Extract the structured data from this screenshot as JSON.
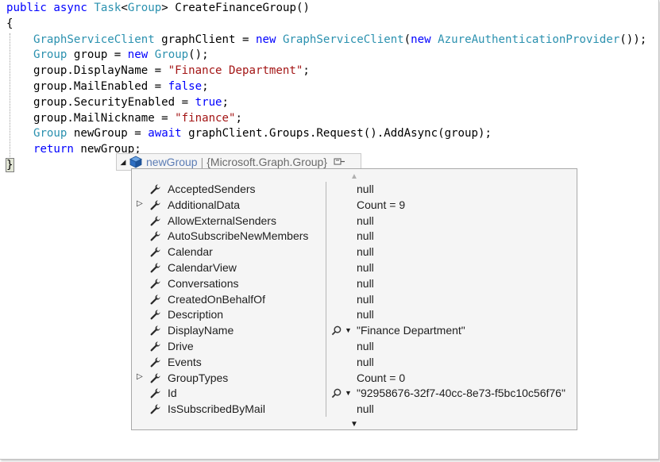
{
  "code_lines": [
    [
      {
        "t": "public",
        "c": "kw"
      },
      {
        "t": " "
      },
      {
        "t": "async",
        "c": "kw"
      },
      {
        "t": " "
      },
      {
        "t": "Task",
        "c": "ty"
      },
      {
        "t": "<"
      },
      {
        "t": "Group",
        "c": "ty"
      },
      {
        "t": "> CreateFinanceGroup()"
      }
    ],
    [
      {
        "t": "{"
      }
    ],
    [
      {
        "t": "    "
      },
      {
        "t": "GraphServiceClient",
        "c": "ty"
      },
      {
        "t": " graphClient = "
      },
      {
        "t": "new",
        "c": "kw"
      },
      {
        "t": " "
      },
      {
        "t": "GraphServiceClient",
        "c": "ty"
      },
      {
        "t": "("
      },
      {
        "t": "new",
        "c": "kw"
      },
      {
        "t": " "
      },
      {
        "t": "AzureAuthenticationProvider",
        "c": "ty"
      },
      {
        "t": "());"
      }
    ],
    [
      {
        "t": "    "
      },
      {
        "t": "Group",
        "c": "ty"
      },
      {
        "t": " group = "
      },
      {
        "t": "new",
        "c": "kw"
      },
      {
        "t": " "
      },
      {
        "t": "Group",
        "c": "ty"
      },
      {
        "t": "();"
      }
    ],
    [
      {
        "t": "    group.DisplayName = "
      },
      {
        "t": "\"Finance Department\"",
        "c": "str"
      },
      {
        "t": ";"
      }
    ],
    [
      {
        "t": "    group.MailEnabled = "
      },
      {
        "t": "false",
        "c": "kw"
      },
      {
        "t": ";"
      }
    ],
    [
      {
        "t": "    group.SecurityEnabled = "
      },
      {
        "t": "true",
        "c": "kw"
      },
      {
        "t": ";"
      }
    ],
    [
      {
        "t": "    group.MailNickname = "
      },
      {
        "t": "\"finance\"",
        "c": "str"
      },
      {
        "t": ";"
      }
    ],
    [
      {
        "t": "    "
      },
      {
        "t": "Group",
        "c": "ty"
      },
      {
        "t": " newGroup = "
      },
      {
        "t": "await",
        "c": "kw"
      },
      {
        "t": " graphClient.Groups.Request().AddAsync(group);"
      }
    ],
    [
      {
        "t": "    "
      },
      {
        "t": "return",
        "c": "kw"
      },
      {
        "t": " newGroup;"
      }
    ],
    [
      {
        "t": "}",
        "c": "brace"
      }
    ]
  ],
  "datatip": {
    "variable_name": "newGroup",
    "type_label": "{Microsoft.Graph.Group}",
    "expander_icon": "collapse-triangle-icon",
    "object_icon": "object-cube-icon",
    "pin_icon": "pin-icon"
  },
  "properties": [
    {
      "name": "AcceptedSenders",
      "value": "null",
      "expandable": false,
      "inspector": false
    },
    {
      "name": "AdditionalData",
      "value": "Count = 9",
      "expandable": true,
      "inspector": false
    },
    {
      "name": "AllowExternalSenders",
      "value": "null",
      "expandable": false,
      "inspector": false
    },
    {
      "name": "AutoSubscribeNewMembers",
      "value": "null",
      "expandable": false,
      "inspector": false
    },
    {
      "name": "Calendar",
      "value": "null",
      "expandable": false,
      "inspector": false
    },
    {
      "name": "CalendarView",
      "value": "null",
      "expandable": false,
      "inspector": false
    },
    {
      "name": "Conversations",
      "value": "null",
      "expandable": false,
      "inspector": false
    },
    {
      "name": "CreatedOnBehalfOf",
      "value": "null",
      "expandable": false,
      "inspector": false
    },
    {
      "name": "Description",
      "value": "null",
      "expandable": false,
      "inspector": false
    },
    {
      "name": "DisplayName",
      "value": "\"Finance Department\"",
      "expandable": false,
      "inspector": true
    },
    {
      "name": "Drive",
      "value": "null",
      "expandable": false,
      "inspector": false
    },
    {
      "name": "Events",
      "value": "null",
      "expandable": false,
      "inspector": false
    },
    {
      "name": "GroupTypes",
      "value": "Count = 0",
      "expandable": true,
      "inspector": false
    },
    {
      "name": "Id",
      "value": "\"92958676-32f7-40cc-8e73-f5bc10c56f76\"",
      "expandable": false,
      "inspector": true
    },
    {
      "name": "IsSubscribedByMail",
      "value": "null",
      "expandable": false,
      "inspector": false
    }
  ],
  "colors": {
    "keyword": "#0000ff",
    "type": "#2b91af",
    "string": "#a31515",
    "datatip_name": "#5c7db5"
  }
}
